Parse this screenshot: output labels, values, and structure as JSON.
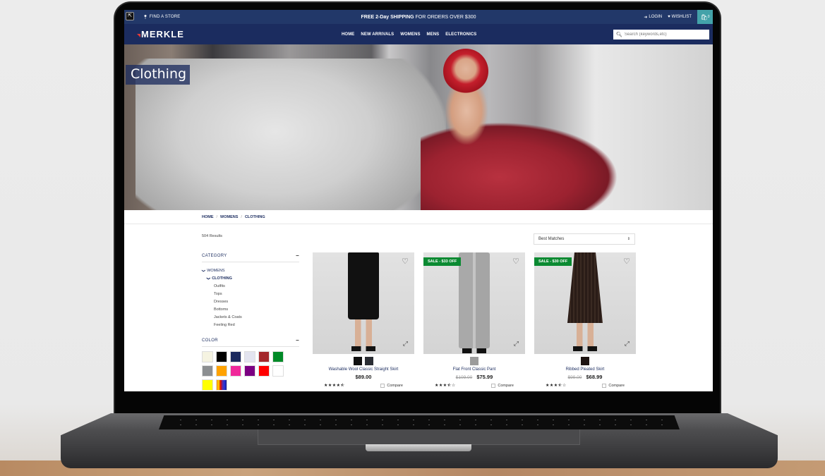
{
  "utility_bar": {
    "store_label": "FIND A STORE",
    "promo_bold": "FREE 2-Day SHIPPING",
    "promo_rest": " FOR ORDERS OVER $300",
    "login_label": "LOGIN",
    "wishlist_label": "WISHLIST",
    "cart_count": "0",
    "bg_color": "#223869",
    "cart_color": "#43a2a9"
  },
  "nav": {
    "logo": "MERKLE",
    "links": [
      "HOME",
      "NEW ARRIVALS",
      "WOMENS",
      "MENS",
      "ELECTRONICS"
    ],
    "search_placeholder": "Search (keywords,etc)",
    "bg_color": "#1b2c5f"
  },
  "hero": {
    "title": "Clothing"
  },
  "breadcrumb": [
    "HOME",
    "WOMENS",
    "CLOTHING"
  ],
  "results": {
    "count_label": "504 Results",
    "sort_selected": "Best Matches"
  },
  "sidebar": {
    "category": {
      "title": "CATEGORY",
      "items": [
        {
          "label": "WOMENS",
          "level": 1,
          "expanded": true
        },
        {
          "label": "CLOTHING",
          "level": 2,
          "expanded": true
        },
        {
          "label": "Outfits",
          "level": 3
        },
        {
          "label": "Tops",
          "level": 3
        },
        {
          "label": "Dresses",
          "level": 3
        },
        {
          "label": "Bottoms",
          "level": 3
        },
        {
          "label": "Jackets & Coats",
          "level": 3
        },
        {
          "label": "Feeling Red",
          "level": 3
        }
      ]
    },
    "color": {
      "title": "COLOR",
      "swatches": [
        "#f5f3e1",
        "#000000",
        "#1c2a5e",
        "#e3e4ef",
        "#a4282c",
        "#008a27",
        "#8c8f91",
        "#ffa200",
        "#f0289a",
        "#7b0082",
        "#ff0000",
        "#ffffff",
        "#ffff00",
        "rainbow"
      ]
    }
  },
  "products": [
    {
      "name": "Washable Wool Classic Straight Skirt",
      "price": "$89.00",
      "original_price": null,
      "sale_badge": null,
      "rating": 4.5,
      "stars": "★★★★⯪",
      "swatches": [
        "#111111",
        "#2a2d33"
      ],
      "compare_label": "Compare"
    },
    {
      "name": "Flat Front Classic Pant",
      "price": "$75.99",
      "original_price": "$109.00",
      "sale_badge": "SALE - $33 OFF",
      "rating": 3.5,
      "stars": "★★★⯪☆",
      "swatches": [
        "#9b9b9b"
      ],
      "compare_label": "Compare"
    },
    {
      "name": "Ribbed Pleated Skirt",
      "price": "$68.99",
      "original_price": "$99.00",
      "sale_badge": "SALE - $30 OFF",
      "rating": 3.5,
      "stars": "★★★⯪☆",
      "swatches": [
        "#1e1412"
      ],
      "compare_label": "Compare"
    }
  ],
  "colors": {
    "sale_green": "#0b8a32",
    "link_navy": "#1b2c5f"
  }
}
